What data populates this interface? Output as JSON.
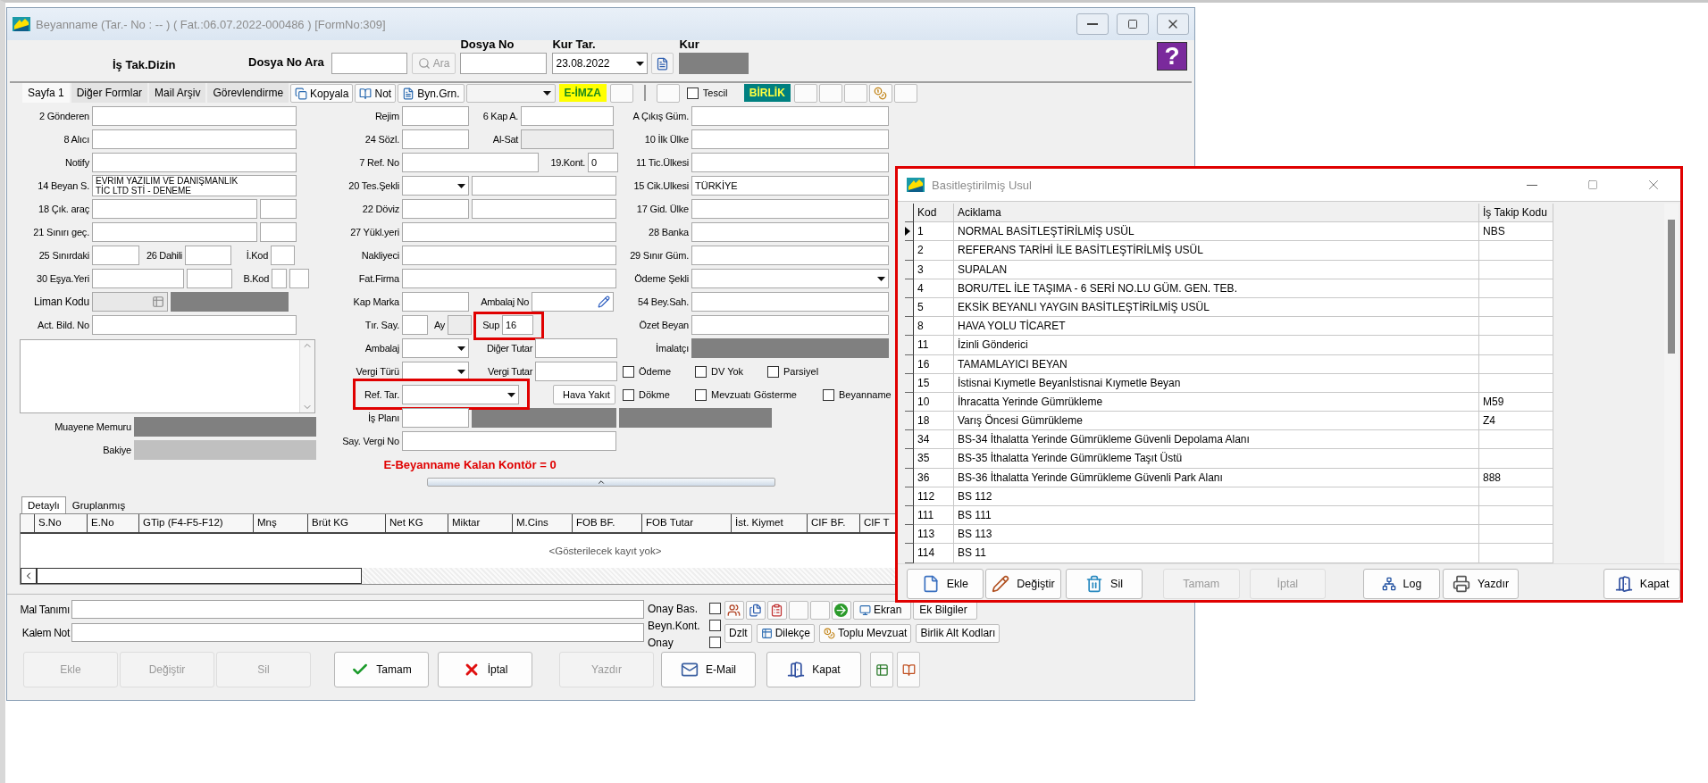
{
  "main_window": {
    "title": "Beyanname (Tar.- No :  --  ) ( Fat.:06.07.2022-000486 )  [FormNo:309]"
  },
  "header": {
    "dizin": "İş Tak.Dizin",
    "search_label": "Dosya No Ara",
    "search_button": "Ara",
    "file_no_label": "Dosya No",
    "rate_date_label": "Kur Tar.",
    "rate_date": "23.08.2022",
    "rate_label": "Kur",
    "help": "?"
  },
  "tabs": [
    {
      "label": "Sayfa 1",
      "selected": true
    },
    {
      "label": "Diğer Formlar",
      "selected": false
    },
    {
      "label": "Mail Arşiv",
      "selected": false
    },
    {
      "label": "Görevlendirme",
      "selected": false
    }
  ],
  "toolbar": [
    {
      "kind": "button",
      "label": "Kopyala"
    },
    {
      "kind": "button",
      "label": "Not"
    },
    {
      "kind": "button",
      "label": "Byn.Grn."
    },
    {
      "kind": "combo"
    },
    {
      "kind": "tag",
      "label": "E-İMZA",
      "color": "#ffff00"
    },
    {
      "kind": "blank"
    },
    {
      "kind": "separator"
    },
    {
      "kind": "blank"
    },
    {
      "kind": "check",
      "label": "Tescil",
      "checked": false
    },
    {
      "kind": "tag",
      "label": "BİRLİK",
      "color": "#008080"
    },
    {
      "kind": "blank"
    },
    {
      "kind": "blank"
    },
    {
      "kind": "blank"
    },
    {
      "kind": "icon"
    },
    {
      "kind": "blank"
    }
  ],
  "form": {
    "left": [
      {
        "label": "2 Gönderen",
        "items": [
          {
            "kind": "field"
          }
        ]
      },
      {
        "label": "8 Alıcı",
        "items": [
          {
            "kind": "field"
          }
        ]
      },
      {
        "label": "Notify",
        "items": [
          {
            "kind": "field"
          }
        ]
      },
      {
        "label": "14 Beyan S.",
        "items": [
          {
            "kind": "memo",
            "lines": [
              "EVRİM YAZILIM VE DANIŞMANLIK",
              "TİC LTD STİ - DENEME"
            ]
          }
        ]
      },
      {
        "label": "18 Çık. araç",
        "items": [
          {
            "kind": "field"
          },
          {
            "kind": "field"
          }
        ]
      },
      {
        "label": "21 Sınırı geç.",
        "items": [
          {
            "kind": "field"
          },
          {
            "kind": "field"
          }
        ]
      },
      {
        "label": "25 Sınırdaki",
        "items": [
          {
            "kind": "field"
          },
          {
            "kind": "label",
            "text": "26 Dahili"
          },
          {
            "kind": "field"
          },
          {
            "kind": "label",
            "text": "İ.Kod"
          },
          {
            "kind": "field"
          }
        ]
      },
      {
        "label": "30 Eşya.Yeri",
        "items": [
          {
            "kind": "field"
          },
          {
            "kind": "field"
          },
          {
            "kind": "label",
            "text": "B.Kod"
          },
          {
            "kind": "field"
          },
          {
            "kind": "field"
          }
        ]
      },
      {
        "label": "Liman Kodu",
        "items": [
          {
            "kind": "lookup"
          },
          {
            "kind": "dark"
          }
        ]
      },
      {
        "label": "Act. Bild. No",
        "items": [
          {
            "kind": "field"
          }
        ]
      }
    ],
    "notes_box": {
      "kind": "memo"
    },
    "info": [
      {
        "label": "Muayene Memuru",
        "items": [
          {
            "kind": "dark"
          }
        ]
      },
      {
        "label": "Bakiye",
        "items": [
          {
            "kind": "muted"
          }
        ]
      }
    ],
    "middle": [
      {
        "label": "Rejim",
        "items": [
          {
            "kind": "field"
          },
          {
            "kind": "label",
            "text": "6 Kap A."
          },
          {
            "kind": "field"
          }
        ]
      },
      {
        "label": "24 Sözl.",
        "items": [
          {
            "kind": "field"
          },
          {
            "kind": "label",
            "text": "Al-Sat"
          },
          {
            "kind": "disabled"
          }
        ]
      },
      {
        "label": "7 Ref. No",
        "items": [
          {
            "kind": "field"
          },
          {
            "kind": "label",
            "text": "19.Kont."
          },
          {
            "kind": "field",
            "value": "0"
          }
        ]
      },
      {
        "label": "20 Tes.Şekli",
        "items": [
          {
            "kind": "combo"
          },
          {
            "kind": "field"
          }
        ]
      },
      {
        "label": "22 Döviz",
        "items": [
          {
            "kind": "field"
          },
          {
            "kind": "field"
          }
        ]
      },
      {
        "label": "27 Yükl.yeri",
        "items": [
          {
            "kind": "field"
          }
        ]
      },
      {
        "label": "Nakliyeci",
        "items": [
          {
            "kind": "field"
          }
        ]
      },
      {
        "label": "Fat.Firma",
        "items": [
          {
            "kind": "field"
          }
        ]
      },
      {
        "label": "Kap Marka",
        "items": [
          {
            "kind": "field"
          },
          {
            "kind": "label",
            "text": "Ambalaj No"
          },
          {
            "kind": "picker"
          }
        ]
      },
      {
        "label": "Tır. Say.",
        "items": [
          {
            "kind": "field"
          },
          {
            "kind": "label",
            "text": "Ay"
          },
          {
            "kind": "disabled"
          },
          {
            "kind": "label",
            "text": "Sup"
          },
          {
            "kind": "field",
            "value": "16",
            "highlighted": true
          }
        ]
      },
      {
        "label": "Ambalaj",
        "items": [
          {
            "kind": "combo"
          },
          {
            "kind": "label",
            "text": "Diğer Tutar"
          },
          {
            "kind": "field"
          }
        ]
      },
      {
        "label": "Vergi Türü",
        "items": [
          {
            "kind": "combo"
          },
          {
            "kind": "label",
            "text": "Vergi Tutar"
          },
          {
            "kind": "field"
          }
        ]
      },
      {
        "label": "Ref. Tar.",
        "items": [
          {
            "kind": "combo",
            "highlighted": true
          },
          {
            "kind": "button",
            "text": "Hava Yakıt"
          }
        ]
      },
      {
        "label": "İş Planı",
        "items": [
          {
            "kind": "field"
          },
          {
            "kind": "dark"
          },
          {
            "kind": "dark"
          }
        ]
      },
      {
        "label": "Say. Vergi No",
        "items": [
          {
            "kind": "field"
          }
        ]
      },
      {
        "items": [
          {
            "kind": "note",
            "text": "E-Beyanname Kalan Kontör = 0"
          }
        ]
      }
    ],
    "right": [
      {
        "label": "A Çıkış Güm.",
        "items": [
          {
            "kind": "field"
          }
        ]
      },
      {
        "label": "10 İlk Ülke",
        "items": [
          {
            "kind": "field"
          }
        ]
      },
      {
        "label": "11 Tic.Ülkesi",
        "items": [
          {
            "kind": "field"
          }
        ]
      },
      {
        "label": "15 Cik.Ulkesi",
        "items": [
          {
            "kind": "field",
            "value": "TÜRKİYE"
          }
        ]
      },
      {
        "label": "17 Gid. Ülke",
        "items": [
          {
            "kind": "field"
          }
        ]
      },
      {
        "label": "28 Banka",
        "items": [
          {
            "kind": "field"
          }
        ]
      },
      {
        "label": "29 Sınır Güm.",
        "items": [
          {
            "kind": "field"
          }
        ]
      },
      {
        "label": "Ödeme Şekli",
        "items": [
          {
            "kind": "combo"
          }
        ]
      },
      {
        "label": "54 Bey.Sah.",
        "items": [
          {
            "kind": "field"
          }
        ]
      },
      {
        "label": "Özet Beyan",
        "items": [
          {
            "kind": "field"
          }
        ]
      },
      {
        "label": "İmalatçı",
        "items": [
          {
            "kind": "dark"
          }
        ]
      },
      {
        "items": [
          {
            "kind": "check",
            "text": "Ödeme",
            "checked": false
          },
          {
            "kind": "check",
            "text": "DV Yok",
            "checked": false
          },
          {
            "kind": "check",
            "text": "Parsiyel",
            "checked": false
          }
        ]
      },
      {
        "items": [
          {
            "kind": "check",
            "text": "Dökme",
            "checked": false
          },
          {
            "kind": "check",
            "text": "Mevzuatı Gösterme",
            "checked": false
          },
          {
            "kind": "check",
            "text": "Beyanname",
            "checked": false
          }
        ]
      }
    ]
  },
  "detail_tabs": [
    {
      "label": "Detaylı",
      "selected": true
    },
    {
      "label": "Gruplanmış",
      "selected": false
    }
  ],
  "items_table": {
    "columns": [
      "S.No",
      "E.No",
      "GTip (F4-F5-F12)",
      "Mnş",
      "Brüt KG",
      "Net KG",
      "Miktar",
      "M.Cins",
      "FOB BF.",
      "FOB Tutar",
      "İst. Kiymet",
      "CIF BF.",
      "CIF T"
    ],
    "empty_text": "<Gösterilecek kayıt yok>"
  },
  "item_fields": [
    {
      "label": "Mal Tanımı"
    },
    {
      "label": "Kalem Not"
    }
  ],
  "approvals": [
    {
      "label": "Onay Bas.",
      "checked": false
    },
    {
      "label": "Beyn.Kont.",
      "checked": false
    },
    {
      "label": "Onay",
      "checked": false
    }
  ],
  "side_tools": [
    {
      "kind": "icon"
    },
    {
      "kind": "icon"
    },
    {
      "kind": "icon"
    },
    {
      "kind": "blank"
    },
    {
      "kind": "blank"
    },
    {
      "kind": "icon"
    },
    {
      "kind": "button",
      "label": "Ekran"
    },
    {
      "kind": "button",
      "label": "Ek Bilgiler"
    }
  ],
  "side_tools_2": [
    {
      "label": "Dzlt"
    },
    {
      "label": "Dilekçe"
    },
    {
      "label": "Toplu Mevzuat"
    },
    {
      "label": "Birlik Alt Kodları"
    }
  ],
  "buttons": [
    {
      "label": "Ekle",
      "disabled": true
    },
    {
      "label": "Değiştir",
      "disabled": true
    },
    {
      "label": "Sil",
      "disabled": true
    },
    {
      "label": "Tamam",
      "disabled": false
    },
    {
      "label": "İptal",
      "disabled": false
    },
    {
      "label": "Yazdır",
      "disabled": true
    },
    {
      "label": "E-Mail",
      "disabled": false
    },
    {
      "label": "Kapat",
      "disabled": false
    }
  ],
  "dialog": {
    "title": "Basitleştirilmiş Usul",
    "highlighted": true,
    "columns": [
      "Kod",
      "Aciklama",
      "İş Takip Kodu"
    ],
    "rows": [
      {
        "kod": "1",
        "aciklama": "NORMAL BASİTLEŞTİRİLMİŞ USÜL",
        "takip": "NBS",
        "selected": true
      },
      {
        "kod": "2",
        "aciklama": "REFERANS TARİHİ İLE BASİTLEŞTİRİLMİŞ USÜL",
        "selected": false
      },
      {
        "kod": "3",
        "aciklama": "SUPALAN",
        "selected": false
      },
      {
        "kod": "4",
        "aciklama": "BORU/TEL İLE TAŞIMA - 6 SERİ NO.LU GÜM. GEN. TEB.",
        "selected": false
      },
      {
        "kod": "5",
        "aciklama": "EKSİK BEYANLI YAYGIN BASİTLEŞTİRİLMİŞ USÜL",
        "selected": false
      },
      {
        "kod": "8",
        "aciklama": "HAVA YOLU TİCARET",
        "selected": false
      },
      {
        "kod": "11",
        "aciklama": "İzinli Gönderici",
        "selected": false
      },
      {
        "kod": "16",
        "aciklama": "TAMAMLAYICI BEYAN",
        "selected": false
      },
      {
        "kod": "15",
        "aciklama": "İstisnai Kıymetle Beyanİstisnai Kıymetle Beyan",
        "selected": false
      },
      {
        "kod": "10",
        "aciklama": "İhracatta Yerinde Gümrükleme",
        "takip": "M59",
        "selected": false
      },
      {
        "kod": "18",
        "aciklama": "Varış Öncesi Gümrükleme",
        "takip": "Z4",
        "selected": false
      },
      {
        "kod": "34",
        "aciklama": "BS-34 İthalatta Yerinde Gümrükleme Güvenli Depolama Alanı",
        "selected": false
      },
      {
        "kod": "35",
        "aciklama": "BS-35 İthalatta Yerinde Gümrükleme Taşıt Üstü",
        "selected": false
      },
      {
        "kod": "36",
        "aciklama": "BS-36 İthalatta Yerinde Gümrükleme Güvenli Park Alanı",
        "takip": "888",
        "selected": false
      },
      {
        "kod": "112",
        "aciklama": "BS 112",
        "selected": false
      },
      {
        "kod": "111",
        "aciklama": "BS 111",
        "selected": false
      },
      {
        "kod": "113",
        "aciklama": "BS 113",
        "selected": false
      },
      {
        "kod": "114",
        "aciklama": "BS 11",
        "selected": false
      }
    ],
    "buttons": [
      {
        "label": "Ekle",
        "disabled": false
      },
      {
        "label": "Değiştir",
        "disabled": false
      },
      {
        "label": "Sil",
        "disabled": false
      },
      {
        "label": "Tamam",
        "disabled": true
      },
      {
        "label": "İptal",
        "disabled": true
      },
      {
        "label": "Log",
        "disabled": false
      },
      {
        "label": "Yazdır",
        "disabled": false
      },
      {
        "label": "Kapat",
        "disabled": false
      }
    ]
  }
}
